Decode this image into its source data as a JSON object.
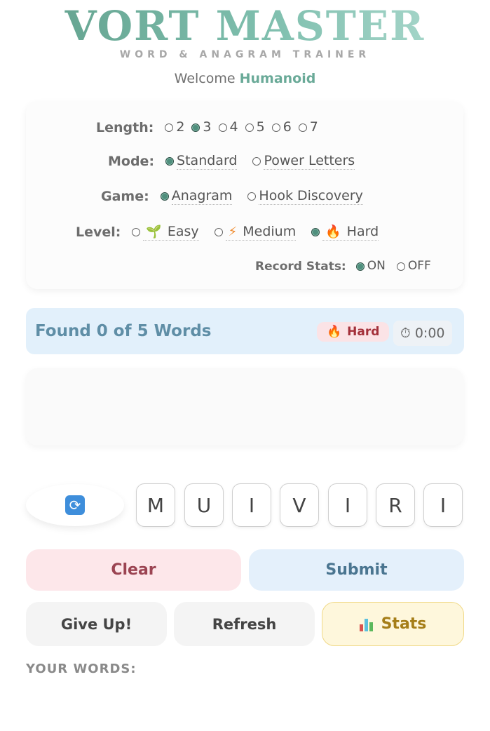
{
  "app": {
    "title": "VORT MASTER",
    "subtitle": "WORD & ANAGRAM TRAINER",
    "welcome_prefix": "Welcome",
    "username": "Humanoid"
  },
  "settings": {
    "length": {
      "label": "Length:",
      "options": [
        "2",
        "3",
        "4",
        "5",
        "6",
        "7"
      ],
      "selected": "3"
    },
    "mode": {
      "label": "Mode:",
      "options": [
        "Standard",
        "Power Letters"
      ],
      "selected": "Standard"
    },
    "game": {
      "label": "Game:",
      "options": [
        "Anagram",
        "Hook Discovery"
      ],
      "selected": "Anagram"
    },
    "level": {
      "label": "Level:",
      "options": [
        {
          "label": "Easy",
          "icon": "seedling-icon"
        },
        {
          "label": "Medium",
          "icon": "lightning-icon"
        },
        {
          "label": "Hard",
          "icon": "fire-icon"
        }
      ],
      "selected": "Hard"
    },
    "record_stats": {
      "label": "Record Stats:",
      "options": [
        "ON",
        "OFF"
      ],
      "selected": "ON"
    }
  },
  "status": {
    "found_text": "Found 0 of 5 Words",
    "difficulty_badge": "Hard",
    "timer": "0:00"
  },
  "tiles": [
    "M",
    "U",
    "I",
    "V",
    "I",
    "R",
    "I"
  ],
  "buttons": {
    "clear": "Clear",
    "submit": "Submit",
    "give_up": "Give Up!",
    "refresh": "Refresh",
    "stats": "Stats"
  },
  "your_words": {
    "label": "YOUR WORDS:",
    "items": []
  },
  "colors": {
    "accent": "#6aaa98",
    "clear_bg": "#fde7ea",
    "submit_bg": "#e4f0fb",
    "stats_bg": "#fef7dc",
    "found_bar_bg": "#e2f0fb"
  }
}
